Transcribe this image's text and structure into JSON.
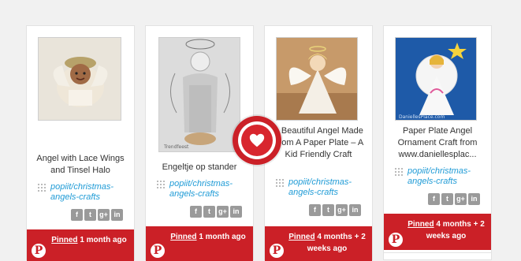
{
  "cards": [
    {
      "title": "Angel with Lace Wings and Tinsel Halo",
      "board": "popiit/christmas-angels-crafts",
      "pinned": "Pinned",
      "ago": "1 month ago",
      "image": "angel-lace-doll"
    },
    {
      "title": "Engeltje op stander",
      "board": "popiit/christmas-angels-crafts",
      "pinned": "Pinned",
      "ago": "1 month ago",
      "image": "wire-angel-on-stand"
    },
    {
      "title": "A Beautiful Angel Made From A Paper Plate – A Kid Friendly Craft",
      "board": "popiit/christmas-angels-crafts",
      "pinned": "Pinned",
      "ago": "4 months + 2 weeks ago",
      "image": "paper-plate-angel"
    },
    {
      "title": "Paper Plate Angel Ornament Craft from www.daniellesplac...",
      "board": "popiit/christmas-angels-crafts",
      "pinned": "Pinned",
      "ago": "4 months + 2 weeks ago",
      "image": "paper-plate-angel-ornament"
    }
  ],
  "social": {
    "facebook": "f",
    "twitter": "t",
    "googleplus": "g+",
    "linkedin": "in"
  },
  "colors": {
    "pin_red": "#cb2027",
    "link_blue": "#1f9bd6",
    "background": "#f1f1f1"
  },
  "icons": [
    "heart-icon",
    "pinterest-icon",
    "board-grid-icon",
    "facebook-icon",
    "twitter-icon",
    "googleplus-icon",
    "linkedin-icon"
  ]
}
